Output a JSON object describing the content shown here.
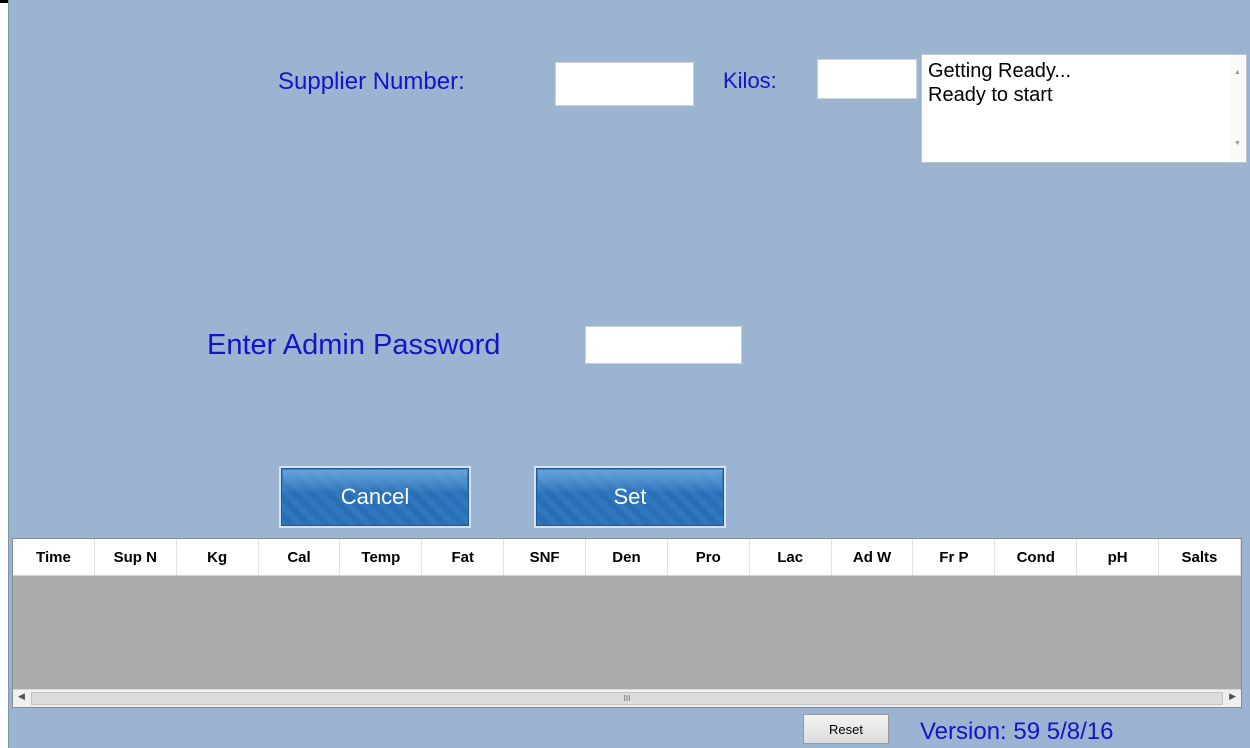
{
  "form": {
    "supplier_label": "Supplier Number:",
    "supplier_value": "",
    "kilos_label": "Kilos:",
    "kilos_value": "",
    "password_label": "Enter Admin Password",
    "password_value": ""
  },
  "log": {
    "lines": [
      "Getting Ready...",
      "Ready to start"
    ]
  },
  "buttons": {
    "cancel": "Cancel",
    "set": "Set",
    "reset": "Reset"
  },
  "table": {
    "columns": [
      "Time",
      "Sup N",
      "Kg",
      "Cal",
      "Temp",
      "Fat",
      "SNF",
      "Den",
      "Pro",
      "Lac",
      "Ad W",
      "Fr P",
      "Cond",
      "pH",
      "Salts"
    ],
    "rows": [],
    "scroll_grip": "III"
  },
  "footer": {
    "version": "Version: 59  5/8/16"
  },
  "colors": {
    "window_bg": "#9ab4d2",
    "label_blue": "#1414c8",
    "button_blue": "#2e78bf",
    "grid_empty": "#ababab"
  }
}
